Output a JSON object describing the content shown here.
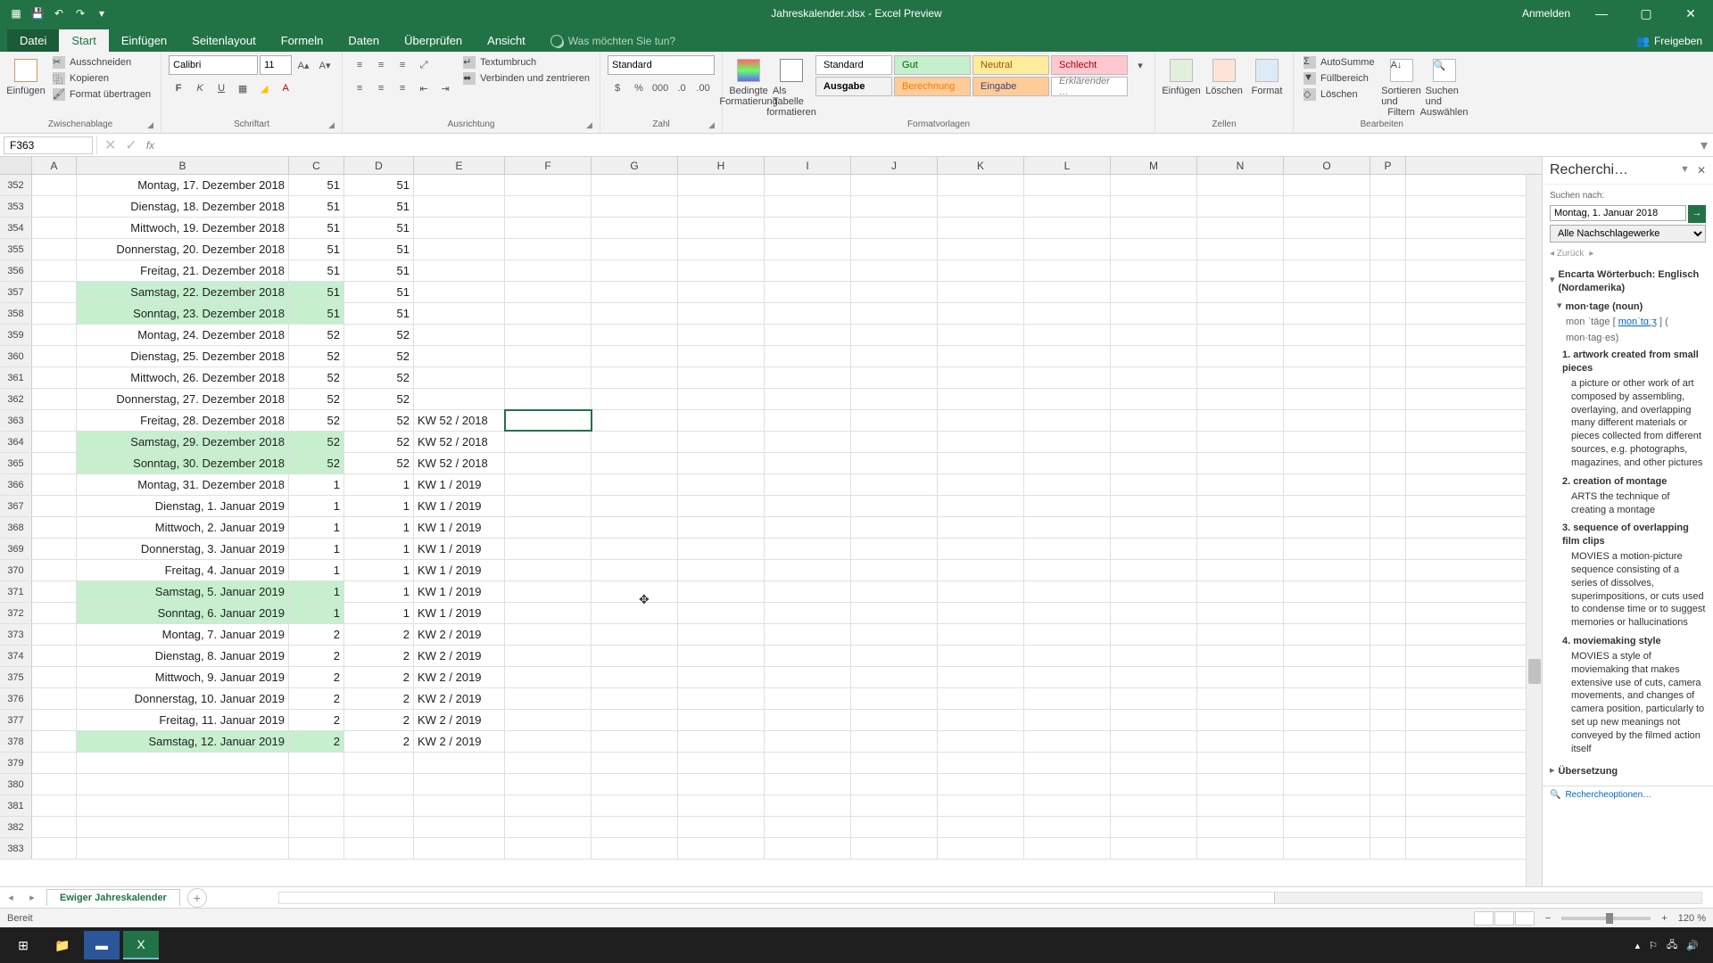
{
  "title": "Jahreskalender.xlsx - Excel Preview",
  "login": "Anmelden",
  "share": "Freigeben",
  "tabs": {
    "file": "Datei",
    "start": "Start",
    "insert": "Einfügen",
    "layout": "Seitenlayout",
    "formulas": "Formeln",
    "data": "Daten",
    "review": "Überprüfen",
    "view": "Ansicht"
  },
  "tell_me": "Was möchten Sie tun?",
  "clipboard": {
    "paste": "Einfügen",
    "cut": "Ausschneiden",
    "copy": "Kopieren",
    "painter": "Format übertragen",
    "label": "Zwischenablage"
  },
  "font": {
    "name": "Calibri",
    "size": "11",
    "label": "Schriftart"
  },
  "alignment": {
    "wrap": "Textumbruch",
    "merge": "Verbinden und zentrieren",
    "label": "Ausrichtung"
  },
  "number": {
    "format": "Standard",
    "label": "Zahl"
  },
  "styles": {
    "cond": "Bedingte",
    "cond2": "Formatierung",
    "table": "Als Tabelle",
    "table2": "formatieren",
    "s1": "Standard",
    "s2": "Gut",
    "s3": "Neutral",
    "s4": "Schlecht",
    "s5": "Ausgabe",
    "s6": "Berechnung",
    "s7": "Eingabe",
    "s8": "Erklärender …",
    "label": "Formatvorlagen"
  },
  "cells": {
    "insert": "Einfügen",
    "delete": "Löschen",
    "format": "Format",
    "label": "Zellen"
  },
  "editing": {
    "sum": "AutoSumme",
    "fill": "Füllbereich",
    "clear": "Löschen",
    "sort": "Sortieren und",
    "sort2": "Filtern",
    "find": "Suchen und",
    "find2": "Auswählen",
    "label": "Bearbeiten"
  },
  "namebox": "F363",
  "columns": [
    "A",
    "B",
    "C",
    "D",
    "E",
    "F",
    "G",
    "H",
    "I",
    "J",
    "K",
    "L",
    "M",
    "N",
    "O",
    "P"
  ],
  "rows": [
    {
      "n": 352,
      "b": "Montag, 17. Dezember 2018",
      "c": "51",
      "d": "51",
      "e": "",
      "w": false
    },
    {
      "n": 353,
      "b": "Dienstag, 18. Dezember 2018",
      "c": "51",
      "d": "51",
      "e": "",
      "w": false
    },
    {
      "n": 354,
      "b": "Mittwoch, 19. Dezember 2018",
      "c": "51",
      "d": "51",
      "e": "",
      "w": false
    },
    {
      "n": 355,
      "b": "Donnerstag, 20. Dezember 2018",
      "c": "51",
      "d": "51",
      "e": "",
      "w": false
    },
    {
      "n": 356,
      "b": "Freitag, 21. Dezember 2018",
      "c": "51",
      "d": "51",
      "e": "",
      "w": false
    },
    {
      "n": 357,
      "b": "Samstag, 22. Dezember 2018",
      "c": "51",
      "d": "51",
      "e": "",
      "w": true
    },
    {
      "n": 358,
      "b": "Sonntag, 23. Dezember 2018",
      "c": "51",
      "d": "51",
      "e": "",
      "w": true
    },
    {
      "n": 359,
      "b": "Montag, 24. Dezember 2018",
      "c": "52",
      "d": "52",
      "e": "",
      "w": false
    },
    {
      "n": 360,
      "b": "Dienstag, 25. Dezember 2018",
      "c": "52",
      "d": "52",
      "e": "",
      "w": false
    },
    {
      "n": 361,
      "b": "Mittwoch, 26. Dezember 2018",
      "c": "52",
      "d": "52",
      "e": "",
      "w": false
    },
    {
      "n": 362,
      "b": "Donnerstag, 27. Dezember 2018",
      "c": "52",
      "d": "52",
      "e": "",
      "w": false
    },
    {
      "n": 363,
      "b": "Freitag, 28. Dezember 2018",
      "c": "52",
      "d": "52",
      "e": "KW 52 / 2018",
      "w": false,
      "sel": true
    },
    {
      "n": 364,
      "b": "Samstag, 29. Dezember 2018",
      "c": "52",
      "d": "52",
      "e": "KW 52 / 2018",
      "w": true
    },
    {
      "n": 365,
      "b": "Sonntag, 30. Dezember 2018",
      "c": "52",
      "d": "52",
      "e": "KW 52 / 2018",
      "w": true
    },
    {
      "n": 366,
      "b": "Montag, 31. Dezember 2018",
      "c": "1",
      "d": "1",
      "e": "KW 1 / 2019",
      "w": false
    },
    {
      "n": 367,
      "b": "Dienstag, 1. Januar 2019",
      "c": "1",
      "d": "1",
      "e": "KW 1 / 2019",
      "w": false
    },
    {
      "n": 368,
      "b": "Mittwoch, 2. Januar 2019",
      "c": "1",
      "d": "1",
      "e": "KW 1 / 2019",
      "w": false
    },
    {
      "n": 369,
      "b": "Donnerstag, 3. Januar 2019",
      "c": "1",
      "d": "1",
      "e": "KW 1 / 2019",
      "w": false
    },
    {
      "n": 370,
      "b": "Freitag, 4. Januar 2019",
      "c": "1",
      "d": "1",
      "e": "KW 1 / 2019",
      "w": false
    },
    {
      "n": 371,
      "b": "Samstag, 5. Januar 2019",
      "c": "1",
      "d": "1",
      "e": "KW 1 / 2019",
      "w": true
    },
    {
      "n": 372,
      "b": "Sonntag, 6. Januar 2019",
      "c": "1",
      "d": "1",
      "e": "KW 1 / 2019",
      "w": true
    },
    {
      "n": 373,
      "b": "Montag, 7. Januar 2019",
      "c": "2",
      "d": "2",
      "e": "KW 2 / 2019",
      "w": false
    },
    {
      "n": 374,
      "b": "Dienstag, 8. Januar 2019",
      "c": "2",
      "d": "2",
      "e": "KW 2 / 2019",
      "w": false
    },
    {
      "n": 375,
      "b": "Mittwoch, 9. Januar 2019",
      "c": "2",
      "d": "2",
      "e": "KW 2 / 2019",
      "w": false
    },
    {
      "n": 376,
      "b": "Donnerstag, 10. Januar 2019",
      "c": "2",
      "d": "2",
      "e": "KW 2 / 2019",
      "w": false
    },
    {
      "n": 377,
      "b": "Freitag, 11. Januar 2019",
      "c": "2",
      "d": "2",
      "e": "KW 2 / 2019",
      "w": false
    },
    {
      "n": 378,
      "b": "Samstag, 12. Januar 2019",
      "c": "2",
      "d": "2",
      "e": "KW 2 / 2019",
      "w": true
    },
    {
      "n": 379,
      "b": "",
      "c": "",
      "d": "",
      "e": "",
      "w": false
    },
    {
      "n": 380,
      "b": "",
      "c": "",
      "d": "",
      "e": "",
      "w": false
    },
    {
      "n": 381,
      "b": "",
      "c": "",
      "d": "",
      "e": "",
      "w": false
    },
    {
      "n": 382,
      "b": "",
      "c": "",
      "d": "",
      "e": "",
      "w": false
    },
    {
      "n": 383,
      "b": "",
      "c": "",
      "d": "",
      "e": "",
      "w": false
    }
  ],
  "research": {
    "title": "Recherchi…",
    "search_label": "Suchen nach:",
    "search_value": "Montag, 1. Januar 2018",
    "source": "Alle Nachschlagewerke",
    "back": "Zurück",
    "dict_head": "Encarta Wörterbuch: Englisch (Nordamerika)",
    "word": "mon·tage (noun)",
    "phon1": "mon ˈtäge [ ",
    "phon_link": "monˈtɑːʒ",
    "phon2": " ] (",
    "phon3": "mon·tag·es)",
    "s1h": "1. artwork created from small pieces",
    "s1": "a picture or other work of art composed by assembling, overlaying, and overlapping many different materials or pieces collected from different sources, e.g. photographs, magazines, and other pictures",
    "s2h": "2. creation of montage",
    "s2": "ARTS the technique of creating a montage",
    "s3h": "3. sequence of overlapping film clips",
    "s3": "MOVIES a motion-picture sequence consisting of a series of dissolves, superimpositions, or cuts used to condense time or to suggest memories or hallucinations",
    "s4h": "4. moviemaking style",
    "s4": "MOVIES a style of moviemaking that makes extensive use of cuts, camera movements, and changes of camera position, particularly to set up new meanings not conveyed by the filmed action itself",
    "translation": "Übersetzung",
    "options": "Rechercheoptionen…"
  },
  "sheet_tab": "Ewiger Jahreskalender",
  "status": "Bereit",
  "zoom": "120 %"
}
